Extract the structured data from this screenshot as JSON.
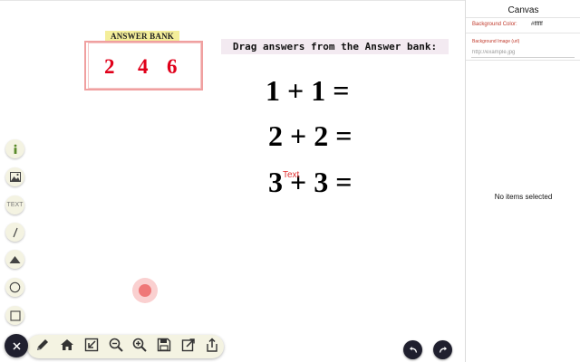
{
  "answer_bank": {
    "title": "ANSWER BANK",
    "answers": [
      "2",
      "4",
      "6"
    ]
  },
  "instruction": "Drag answers from the Answer bank:",
  "equations": [
    "1 + 1 =",
    "2 + 2 =",
    "3 + 3 ="
  ],
  "text_object": "Text",
  "left_toolbar": {
    "text_tool_label": "TEXT",
    "items": [
      "info-icon",
      "image-icon",
      "text-tool",
      "line-icon",
      "triangle-icon",
      "circle-icon",
      "square-icon"
    ]
  },
  "bottom_toolbar": {
    "items": [
      "close-icon",
      "pencil-icon",
      "home-icon",
      "import-icon",
      "zoom-out-icon",
      "zoom-in-icon",
      "save-icon",
      "export-icon",
      "share-icon"
    ]
  },
  "history": [
    "undo-icon",
    "redo-icon"
  ],
  "panel": {
    "title": "Canvas",
    "bg_color_label": "Background Color:",
    "bg_color_value": "#ffffff",
    "bg_image_label": "Background Image (url)",
    "bg_image_placeholder": "http://example.jpg",
    "empty_text": "No items selected"
  },
  "colors": {
    "answer_red": "#e0001a",
    "bank_title_bg": "#f4ee9a",
    "toolbar_bg": "#f4f3e2",
    "dark_button": "#1f1f2e"
  }
}
